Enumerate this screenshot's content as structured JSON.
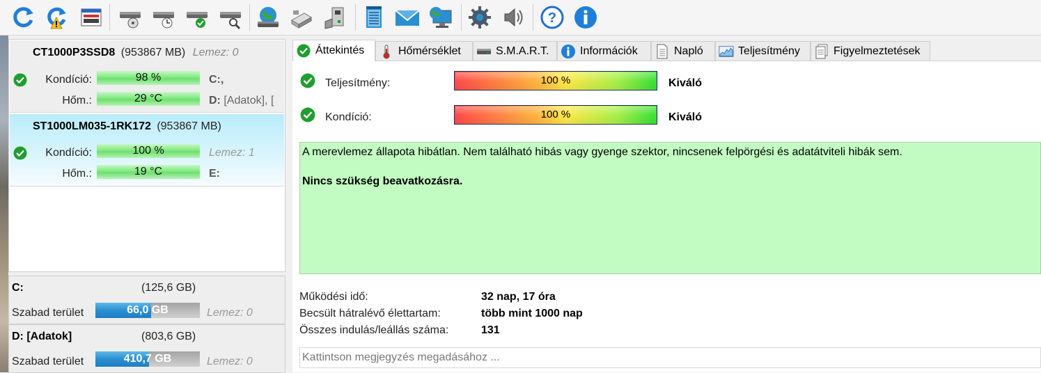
{
  "toolbar": {
    "buttons": [
      {
        "icon": "refresh-icon",
        "tooltip": ""
      },
      {
        "icon": "refresh-warning-icon",
        "tooltip": ""
      },
      {
        "icon": "disk-list-icon",
        "tooltip": ""
      },
      {
        "icon": "drive-cd-icon",
        "tooltip": ""
      },
      {
        "icon": "drive-clock-icon",
        "tooltip": ""
      },
      {
        "icon": "drive-check-icon",
        "tooltip": ""
      },
      {
        "icon": "drive-search-icon",
        "tooltip": ""
      },
      {
        "icon": "network-drive-icon",
        "tooltip": ""
      },
      {
        "icon": "usb-drive-icon",
        "tooltip": ""
      },
      {
        "icon": "usb-drive-2-icon",
        "tooltip": ""
      },
      {
        "icon": "notepad-icon",
        "tooltip": ""
      },
      {
        "icon": "mail-icon",
        "tooltip": ""
      },
      {
        "icon": "network-computer-icon",
        "tooltip": ""
      },
      {
        "icon": "settings-gear-icon",
        "tooltip": ""
      },
      {
        "icon": "speaker-icon",
        "tooltip": ""
      },
      {
        "icon": "help-icon",
        "tooltip": ""
      },
      {
        "icon": "info-icon",
        "tooltip": ""
      }
    ]
  },
  "disks": [
    {
      "model": "CT1000P3SSD8",
      "size": "(953867 MB)",
      "lemez": "Lemez: 0",
      "health_label": "Kondíció:",
      "health_value": "98 %",
      "temp_label": "Hőm.:",
      "temp_value": "29 °C",
      "drive1": "C:,",
      "drive2_letter": "D:",
      "drive2_rest": "[Adatok],",
      "drive2_extra": "["
    },
    {
      "model": "ST1000LM035-1RK172",
      "size": "(953867 MB)",
      "lemez": "Lemez: 1",
      "health_label": "Kondíció:",
      "health_value": "100 %",
      "temp_label": "Hőm.:",
      "temp_value": "19 °C",
      "drive1": "E:"
    }
  ],
  "volumes": [
    {
      "name": "C:",
      "size": "(125,6 GB)",
      "free_label": "Szabad terület",
      "free_value": "66,0 GB",
      "free_fraction": 0.53,
      "lemez": "Lemez: 0"
    },
    {
      "name": "D: [Adatok]",
      "size": "(803,6 GB)",
      "free_label": "Szabad terület",
      "free_value": "410,7 GB",
      "free_fraction": 0.51,
      "lemez": "Lemez: 0"
    }
  ],
  "tabs": [
    {
      "label": "Áttekintés",
      "icon": "check-icon",
      "active": true
    },
    {
      "label": "Hőmérséklet",
      "icon": "thermometer-icon"
    },
    {
      "label": "S.M.A.R.T.",
      "icon": "drive-icon"
    },
    {
      "label": "Információk",
      "icon": "info-icon"
    },
    {
      "label": "Napló",
      "icon": "document-icon"
    },
    {
      "label": "Teljesítmény",
      "icon": "performance-graph-icon"
    },
    {
      "label": "Figyelmeztetések",
      "icon": "warnings-doc-icon"
    }
  ],
  "overview": {
    "performance_label": "Teljesítmény:",
    "performance_value": "100 %",
    "performance_verdict": "Kiváló",
    "health_label": "Kondíció:",
    "health_value": "100 %",
    "health_verdict": "Kiváló",
    "status_text": "A merevlemez állapota hibátlan. Nem található hibás vagy gyenge szektor, nincsenek felpörgési és adatátviteli hibák sem.",
    "status_action": "Nincs szükség beavatkozásra.",
    "uptime_label": "Működési idő:",
    "uptime_value": "32 nap, 17 óra",
    "lifetime_label": "Becsült hátralévő élettartam:",
    "lifetime_value": "több mint 1000 nap",
    "starts_label": "Összes indulás/leállás száma:",
    "starts_value": "131",
    "note_placeholder": "Kattintson megjegyzés megadásához ..."
  },
  "colors": {
    "ok_green": "#1f9e2e",
    "status_bg": "#c2fcc2",
    "selected_disk_bg": "#b9ecfb",
    "free_bar_blue": "#2a8fd0"
  }
}
